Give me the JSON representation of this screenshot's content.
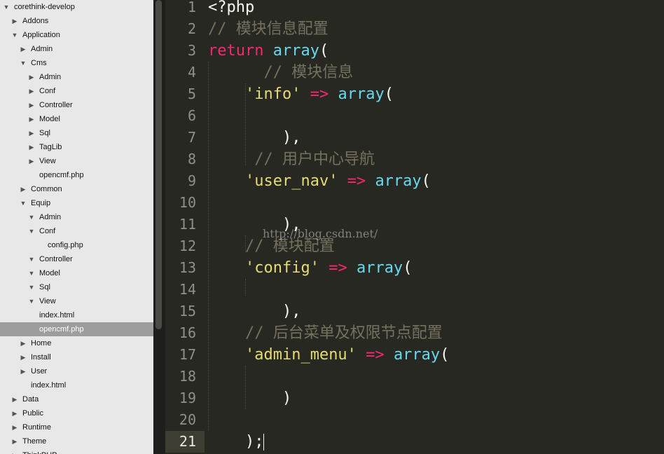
{
  "sidebar": {
    "items": [
      {
        "label": "corethink-develop",
        "depth": 0,
        "arrow": "down"
      },
      {
        "label": "Addons",
        "depth": 1,
        "arrow": "right"
      },
      {
        "label": "Application",
        "depth": 1,
        "arrow": "down"
      },
      {
        "label": "Admin",
        "depth": 2,
        "arrow": "right"
      },
      {
        "label": "Cms",
        "depth": 2,
        "arrow": "down"
      },
      {
        "label": "Admin",
        "depth": 3,
        "arrow": "right"
      },
      {
        "label": "Conf",
        "depth": 3,
        "arrow": "right"
      },
      {
        "label": "Controller",
        "depth": 3,
        "arrow": "right"
      },
      {
        "label": "Model",
        "depth": 3,
        "arrow": "right"
      },
      {
        "label": "Sql",
        "depth": 3,
        "arrow": "right"
      },
      {
        "label": "TagLib",
        "depth": 3,
        "arrow": "right"
      },
      {
        "label": "View",
        "depth": 3,
        "arrow": "right"
      },
      {
        "label": "opencmf.php",
        "depth": 3,
        "arrow": "none"
      },
      {
        "label": "Common",
        "depth": 2,
        "arrow": "right"
      },
      {
        "label": "Equip",
        "depth": 2,
        "arrow": "down"
      },
      {
        "label": "Admin",
        "depth": 3,
        "arrow": "down"
      },
      {
        "label": "Conf",
        "depth": 3,
        "arrow": "down"
      },
      {
        "label": "config.php",
        "depth": 4,
        "arrow": "none"
      },
      {
        "label": "Controller",
        "depth": 3,
        "arrow": "down"
      },
      {
        "label": "Model",
        "depth": 3,
        "arrow": "down"
      },
      {
        "label": "Sql",
        "depth": 3,
        "arrow": "down"
      },
      {
        "label": "View",
        "depth": 3,
        "arrow": "down"
      },
      {
        "label": "index.html",
        "depth": 3,
        "arrow": "none"
      },
      {
        "label": "opencmf.php",
        "depth": 3,
        "arrow": "none",
        "selected": true
      },
      {
        "label": "Home",
        "depth": 2,
        "arrow": "right"
      },
      {
        "label": "Install",
        "depth": 2,
        "arrow": "right"
      },
      {
        "label": "User",
        "depth": 2,
        "arrow": "right"
      },
      {
        "label": "index.html",
        "depth": 2,
        "arrow": "none"
      },
      {
        "label": "Data",
        "depth": 1,
        "arrow": "right"
      },
      {
        "label": "Public",
        "depth": 1,
        "arrow": "right"
      },
      {
        "label": "Runtime",
        "depth": 1,
        "arrow": "right"
      },
      {
        "label": "Theme",
        "depth": 1,
        "arrow": "right"
      },
      {
        "label": "ThinkPHP",
        "depth": 1,
        "arrow": "right"
      }
    ]
  },
  "editor": {
    "active_line": 21,
    "lines": [
      [
        {
          "t": "<?php",
          "c": "plain"
        }
      ],
      [
        {
          "t": "// 模块信息配置",
          "c": "comment"
        }
      ],
      [
        {
          "t": "return",
          "c": "kw"
        },
        {
          "t": " ",
          "c": "plain"
        },
        {
          "t": "array",
          "c": "fn"
        },
        {
          "t": "(",
          "c": "plain"
        }
      ],
      [
        {
          "t": "      // 模块信息",
          "c": "comment"
        }
      ],
      [
        {
          "t": "    ",
          "c": "plain"
        },
        {
          "t": "'info'",
          "c": "str"
        },
        {
          "t": " ",
          "c": "plain"
        },
        {
          "t": "=>",
          "c": "op"
        },
        {
          "t": " ",
          "c": "plain"
        },
        {
          "t": "array",
          "c": "fn"
        },
        {
          "t": "(",
          "c": "plain"
        }
      ],
      [],
      [
        {
          "t": "        ),",
          "c": "plain"
        }
      ],
      [
        {
          "t": "     // 用户中心导航",
          "c": "comment"
        }
      ],
      [
        {
          "t": "    ",
          "c": "plain"
        },
        {
          "t": "'user_nav'",
          "c": "str"
        },
        {
          "t": " ",
          "c": "plain"
        },
        {
          "t": "=>",
          "c": "op"
        },
        {
          "t": " ",
          "c": "plain"
        },
        {
          "t": "array",
          "c": "fn"
        },
        {
          "t": "(",
          "c": "plain"
        }
      ],
      [],
      [
        {
          "t": "        ),",
          "c": "plain"
        }
      ],
      [
        {
          "t": "    // 模块配置",
          "c": "comment"
        }
      ],
      [
        {
          "t": "    ",
          "c": "plain"
        },
        {
          "t": "'config'",
          "c": "str"
        },
        {
          "t": " ",
          "c": "plain"
        },
        {
          "t": "=>",
          "c": "op"
        },
        {
          "t": " ",
          "c": "plain"
        },
        {
          "t": "array",
          "c": "fn"
        },
        {
          "t": "(",
          "c": "plain"
        }
      ],
      [],
      [
        {
          "t": "        ),",
          "c": "plain"
        }
      ],
      [
        {
          "t": "    // 后台菜单及权限节点配置",
          "c": "comment"
        }
      ],
      [
        {
          "t": "    ",
          "c": "plain"
        },
        {
          "t": "'admin_menu'",
          "c": "str"
        },
        {
          "t": " ",
          "c": "plain"
        },
        {
          "t": "=>",
          "c": "op"
        },
        {
          "t": " ",
          "c": "plain"
        },
        {
          "t": "array",
          "c": "fn"
        },
        {
          "t": "(",
          "c": "plain"
        }
      ],
      [],
      [
        {
          "t": "        )",
          "c": "plain"
        }
      ],
      [],
      [
        {
          "t": "    );",
          "c": "plain"
        }
      ]
    ]
  },
  "watermark": "http://blog.csdn.net/",
  "colors": {
    "editor_bg": "#272822",
    "sidebar_bg": "#e8e8e8",
    "comment": "#75715e",
    "keyword": "#f92672",
    "function": "#66d9ef",
    "string": "#e6db74"
  }
}
